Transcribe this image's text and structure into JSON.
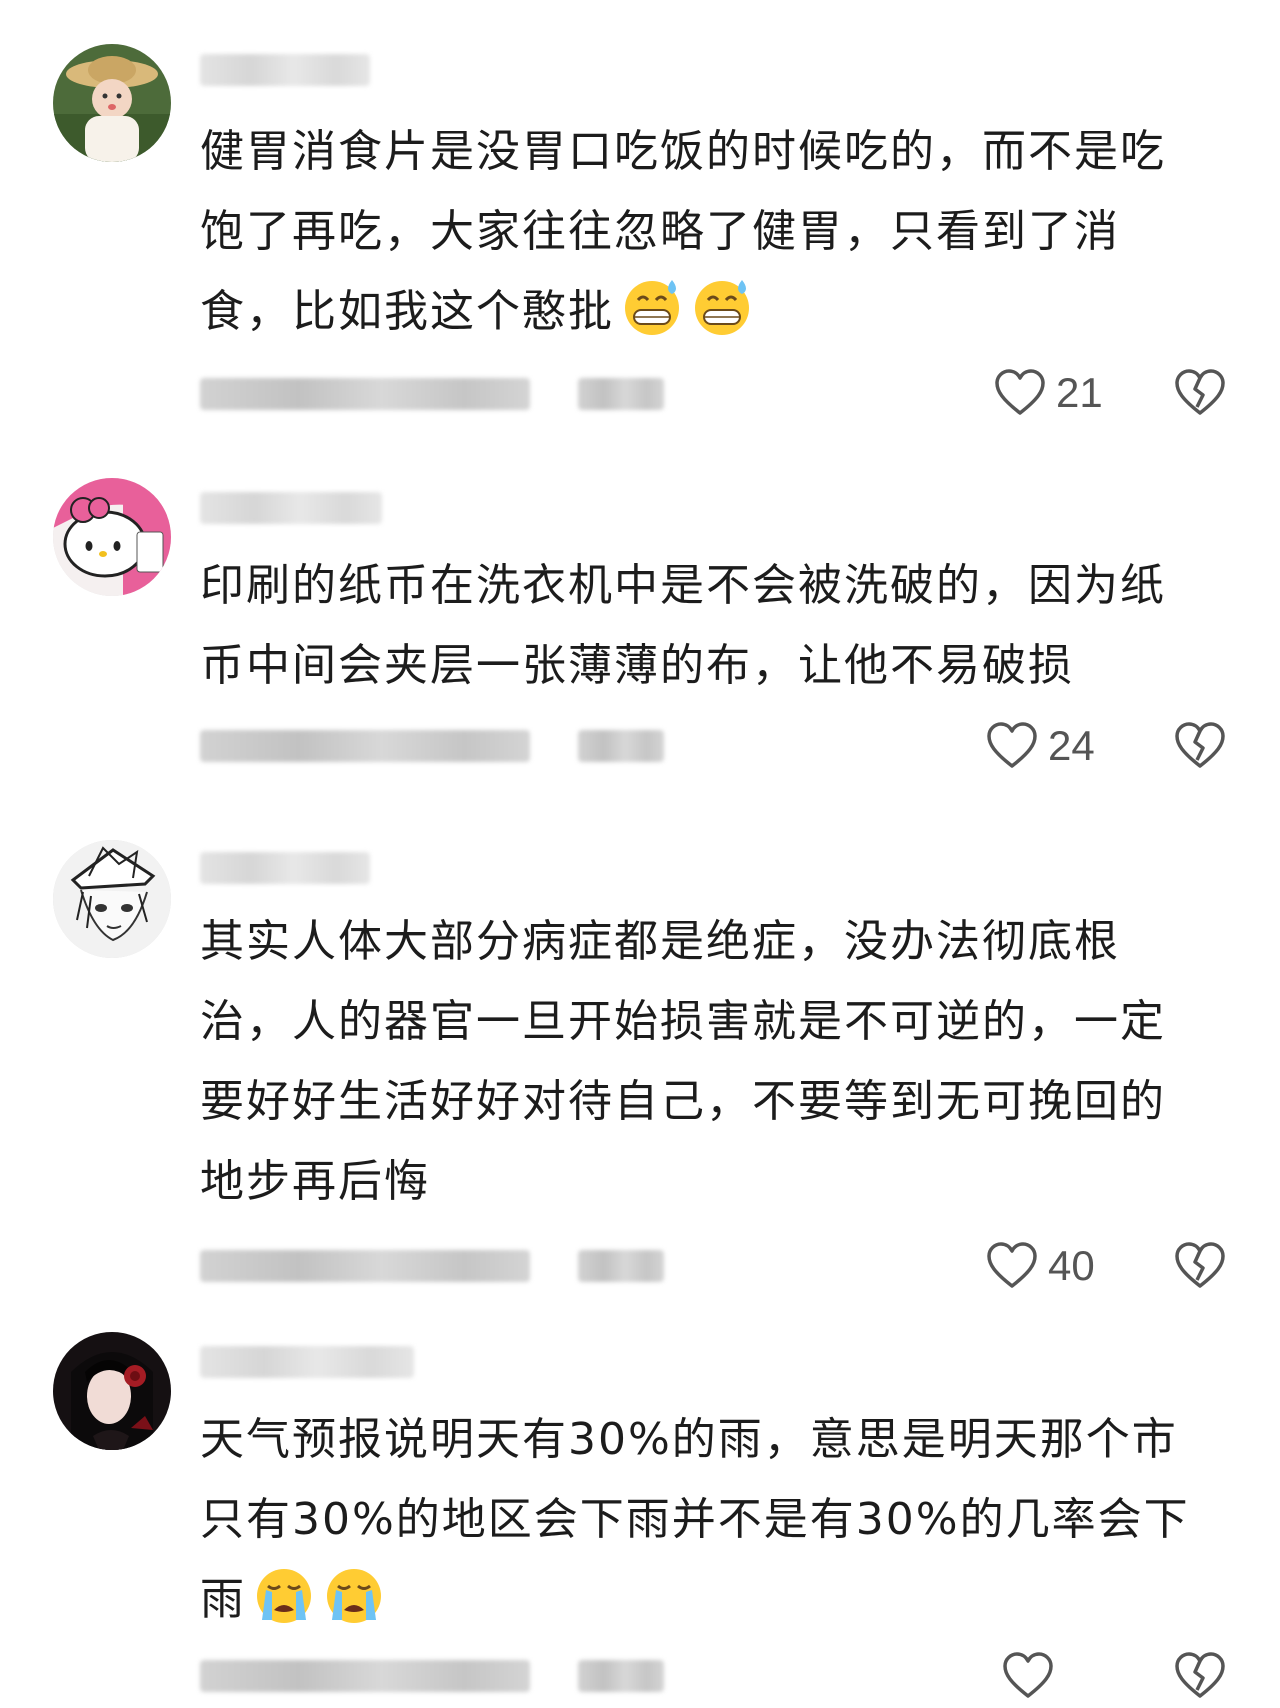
{
  "comments": [
    {
      "text": "健胃消食片是没胃口吃饭的时候吃的，而不是吃饱了再吃，大家往往忽略了健胃，只看到了消食，比如我这个憨批",
      "emojis": [
        "sweat-grin-emoji",
        "sweat-grin-emoji"
      ],
      "likes": "21",
      "avatar": "girl-straw-hat-avatar"
    },
    {
      "text": "印刷的纸币在洗衣机中是不会被洗破的，因为纸币中间会夹层一张薄薄的布，让他不易破损",
      "emojis": [],
      "likes": "24",
      "avatar": "hello-kitty-avatar"
    },
    {
      "text": "其实人体大部分病症都是绝症，没办法彻底根治，人的器官一旦开始损害就是不可逆的，一定要好好生活好好对待自己，不要等到无可挽回的地步再后悔",
      "emojis": [],
      "likes": "40",
      "avatar": "anime-sketch-avatar"
    },
    {
      "text": "天气预报说明天有30%的雨，意思是明天那个市只有30%的地区会下雨并不是有30%的几率会下雨",
      "emojis": [
        "crying-emoji",
        "crying-emoji"
      ],
      "likes": "",
      "avatar": "dark-hair-portrait-avatar"
    }
  ],
  "colors": {
    "text": "#1c1c1c",
    "meta_gray": "#999999",
    "icon_gray": "#555555"
  }
}
